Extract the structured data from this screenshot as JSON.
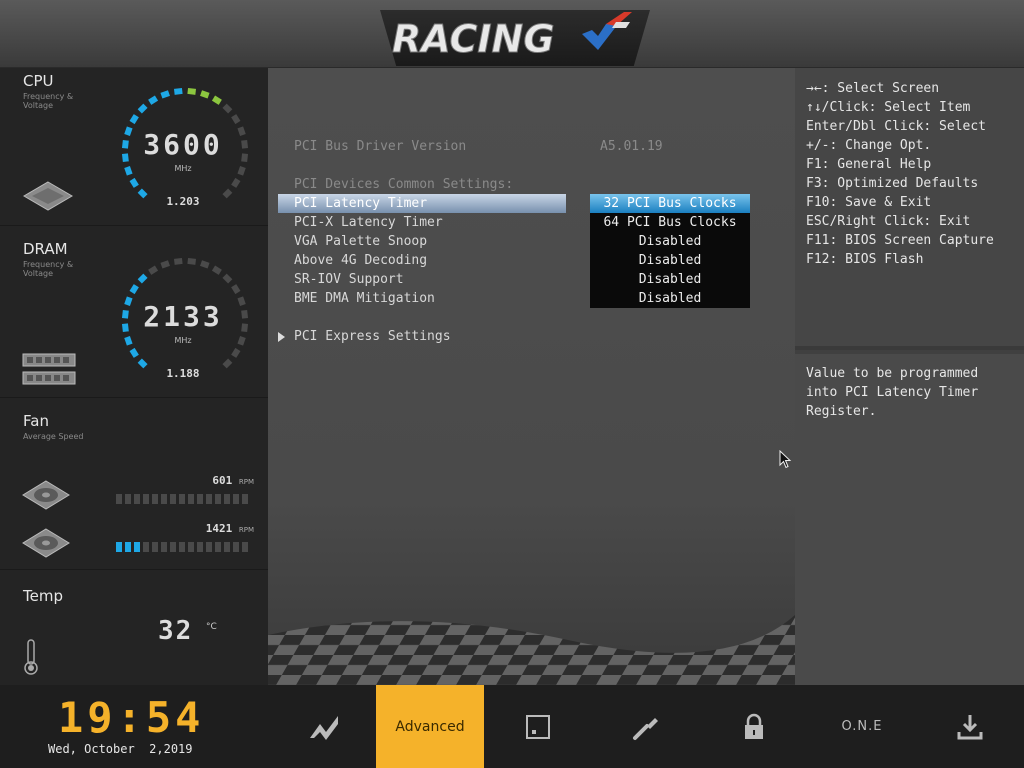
{
  "header": {
    "logo_text": "RACING"
  },
  "sidebar": {
    "cpu": {
      "title": "CPU",
      "subtitle": "Frequency & Voltage",
      "value": "3600",
      "unit": "MHz",
      "voltage": "1.203",
      "level": 0.62
    },
    "dram": {
      "title": "DRAM",
      "subtitle": "Frequency & Voltage",
      "value": "2133",
      "unit": "MHz",
      "voltage": "1.188",
      "level": 0.35
    },
    "fan": {
      "title": "Fan",
      "subtitle": "Average Speed",
      "fans": [
        {
          "rpm": "601",
          "unit": "RPM",
          "level": 0
        },
        {
          "rpm": "1421",
          "unit": "RPM",
          "level": 3
        }
      ]
    },
    "temp": {
      "title": "Temp",
      "value": "32",
      "unit": "°C"
    }
  },
  "main": {
    "driver_label": "PCI Bus Driver Version",
    "driver_value": "A5.01.19",
    "section_label": "PCI Devices Common Settings:",
    "items": [
      {
        "label": "PCI Latency Timer",
        "value": "32 PCI Bus Clocks"
      },
      {
        "label": "PCI-X Latency Timer",
        "value": "64 PCI Bus Clocks"
      },
      {
        "label": "VGA Palette Snoop",
        "value": "Disabled"
      },
      {
        "label": "Above 4G Decoding",
        "value": "Disabled"
      },
      {
        "label": "SR-IOV Support",
        "value": "Disabled"
      },
      {
        "label": "BME DMA Mitigation",
        "value": "Disabled"
      }
    ],
    "submenu": "PCI Express Settings"
  },
  "help": {
    "keys": [
      "→←: Select Screen",
      "↑↓/Click: Select Item",
      "Enter/Dbl Click: Select",
      "+/-: Change Opt.",
      "F1: General Help",
      "F3: Optimized Defaults",
      "F10: Save & Exit",
      "ESC/Right Click: Exit",
      "F11: BIOS Screen Capture",
      "F12: BIOS Flash"
    ],
    "description": [
      "Value to be programmed",
      "into PCI Latency Timer",
      "Register."
    ]
  },
  "bottom": {
    "time": "19:54",
    "date": "Wed, October  2,2019",
    "tabs": {
      "advanced": "Advanced",
      "one": "O.N.E"
    }
  },
  "colors": {
    "accent": "#f5b22a",
    "selected": "#1b7fc0",
    "gauge_blue": "#1ea8e6",
    "gauge_green": "#8cc63f",
    "gauge_orange": "#f5a623"
  }
}
